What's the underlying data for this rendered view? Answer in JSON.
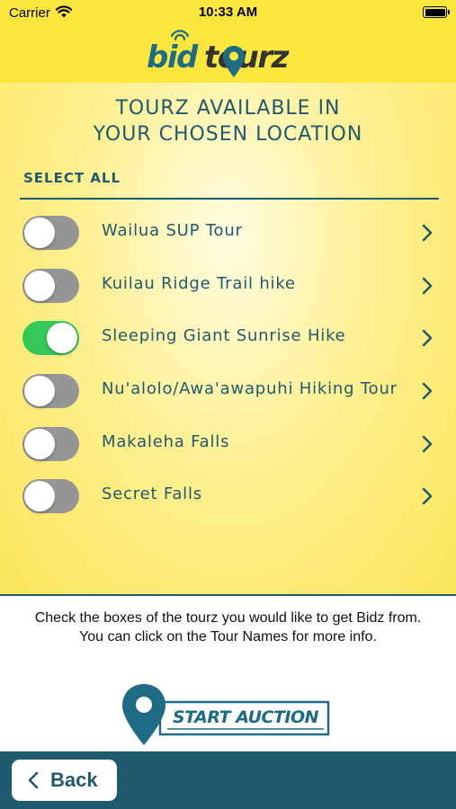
{
  "status_bar": {
    "carrier": "Carrier",
    "time": "10:33 AM"
  },
  "header": {
    "logo_part1": "bid",
    "logo_part2": "tourz"
  },
  "main": {
    "title_line1": "TOURZ AVAILABLE IN",
    "title_line2": "YOUR CHOSEN LOCATION",
    "select_all": "SELECT ALL",
    "tours": [
      {
        "name": "Wailua SUP Tour",
        "selected": false
      },
      {
        "name": "Kuilau Ridge Trail hike",
        "selected": false
      },
      {
        "name": "Sleeping Giant Sunrise Hike",
        "selected": true
      },
      {
        "name": "Nu'alolo/Awa'awapuhi Hiking Tour",
        "selected": false
      },
      {
        "name": "Makaleha Falls",
        "selected": false
      },
      {
        "name": "Secret Falls",
        "selected": false
      }
    ]
  },
  "info": {
    "text": "Check the boxes of the tourz you would like to get Bidz from. You can click on the Tour Names for more info.",
    "start_auction_label": "START AUCTION"
  },
  "bottom_bar": {
    "back_label": "Back"
  },
  "colors": {
    "brand_yellow": "#fbe63d",
    "brand_teal": "#1f5a6e",
    "toggle_on": "#34c759",
    "toggle_off": "#959595"
  },
  "icons": {
    "wifi": "wifi-icon",
    "battery": "battery-icon",
    "chevron": "chevron-right-icon",
    "back": "chevron-left-icon",
    "pin": "location-pin-icon"
  }
}
